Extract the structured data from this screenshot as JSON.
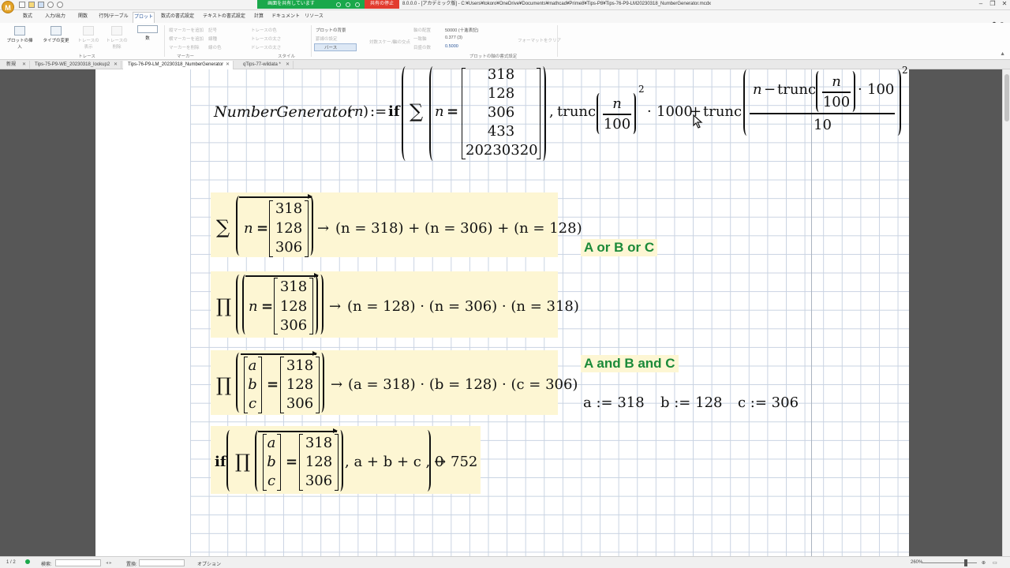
{
  "titlebar": {
    "share_status": "画面を共有しています",
    "stop_share": "共有の停止",
    "window_title": "8.0.0.0 - [アカデミック版] - C:¥Users¥tokoro¥OneDrive¥Documents¥mathcad¥Prime8¥Tips-P8¥Tips-76-P9-LM20230318_NumberGenerator.mcdx",
    "minimize": "–",
    "restore": "❐",
    "close": "✕",
    "logo": "M"
  },
  "ribbon": {
    "tabs": [
      "数式",
      "入力/出力",
      "関数",
      "行列/テーブル",
      "プロット",
      "数式の書式設定",
      "テキストの書式設定",
      "計算",
      "ドキュメント",
      "リソース"
    ],
    "active_tab": "プロット",
    "insert_plot": "プロットの挿入",
    "change_type": "タイプの変更",
    "trace_tools": [
      "トレースの表示",
      "トレースの削除"
    ],
    "trace_number_label": "数",
    "marker_items": [
      "縦マーカーを追加",
      "横マーカーを追加",
      "マーカーを削除"
    ],
    "trace_style": [
      "記号",
      "線種",
      "線の色",
      "トレースの色",
      "トレースの太さ",
      "ドレースの太さ"
    ],
    "plot_background": "プロットの背景",
    "grid_line": "罫線の設定",
    "axis_type": "バース",
    "axis_tools": [
      "対数スケール",
      "軸の交点",
      "軸の配置",
      "一致軸",
      "目盛の数",
      "軸の位置"
    ],
    "number_format": "50000 (十進表記)",
    "precision": "0.377 (3)",
    "format_sample": "0.5000",
    "format_painter": "フォーマットをクリア",
    "group_labels": [
      "トレース",
      "マーカー",
      "スタイル",
      "プロットの軸の書式設定"
    ]
  },
  "doc_tabs": [
    {
      "label": "新規",
      "active": false
    },
    {
      "label": "Tips-75-P9-WE_20230318_lookup2",
      "active": false
    },
    {
      "label": "Tips-76-P9-LM_20230318_NumberGenerator",
      "active": true
    },
    {
      "label": "qTips-77-wildata *",
      "active": false
    }
  ],
  "worksheet": {
    "top_def": {
      "fname": "NumberGenerator",
      "arg": "n",
      "assign": ":=",
      "kw_if": "if",
      "sum": "∑",
      "var": "n",
      "eq": "=",
      "vector": [
        "318",
        "128",
        "306",
        "433",
        "20230320"
      ],
      "trunc": "trunc",
      "frac_num": "n",
      "frac_den": "100",
      "exponent": "2",
      "mul_dot": "·",
      "mult": "1000",
      "plus": "+",
      "inner_minus": "−",
      "inner_mult": "100",
      "outer_den": "10",
      "comma": ","
    },
    "block1": {
      "op": "∑",
      "var": "n",
      "vector": [
        "318",
        "128",
        "306"
      ],
      "arrow": "→",
      "result": "(n = 318) + (n = 306) + (n = 128)"
    },
    "block2": {
      "op": "∏",
      "var": "n",
      "vector": [
        "318",
        "128",
        "306"
      ],
      "arrow": "→",
      "result": "(n = 128) · (n = 306) · (n = 318)"
    },
    "block3": {
      "op": "∏",
      "vars": [
        "a",
        "b",
        "c"
      ],
      "vector": [
        "318",
        "128",
        "306"
      ],
      "arrow": "→",
      "result": "(a = 318) · (b = 128) · (c = 306)"
    },
    "block4": {
      "kw_if": "if",
      "op": "∏",
      "vars": [
        "a",
        "b",
        "c"
      ],
      "vector": [
        "318",
        "128",
        "306"
      ],
      "tail": ", a + b + c , 0",
      "arrow": "→",
      "result": "752"
    },
    "label_or": "A or B or C",
    "label_and": "A and B and C",
    "assignments": [
      "a := 318",
      "b := 128",
      "c := 306"
    ]
  },
  "statusbar": {
    "page": "1 / 2",
    "search_label": "検索:",
    "replace_label": "置換:",
    "options": "オプション",
    "zoom": "260%"
  },
  "colors": {
    "highlight": "#fdf6d3",
    "label_green": "#1b8a39",
    "share_green": "#1aa84b",
    "stop_red": "#e23b2e",
    "grid": "#c9d3e2"
  }
}
